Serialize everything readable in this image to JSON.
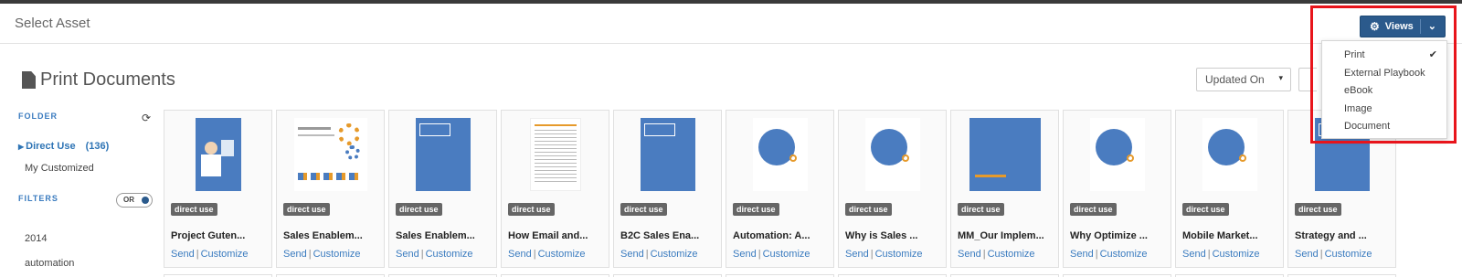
{
  "modal": {
    "title": "Select Asset"
  },
  "views": {
    "button_label": "Views",
    "menu": [
      {
        "label": "Print",
        "checked": true
      },
      {
        "label": "External Playbook",
        "checked": false
      },
      {
        "label": "eBook",
        "checked": false
      },
      {
        "label": "Image",
        "checked": false
      },
      {
        "label": "Document",
        "checked": false
      }
    ],
    "check_glyph": "✔"
  },
  "section": {
    "title": "Print Documents"
  },
  "sort": {
    "selected": "Updated On"
  },
  "sidebar": {
    "folder_label": "FOLDER",
    "folders": [
      {
        "label": "Direct Use",
        "count": "(136)",
        "active": true
      },
      {
        "label": "My Customized",
        "count": "",
        "active": false
      }
    ],
    "filters_label": "FILTERS",
    "toggle_label": "OR",
    "filters": [
      "2014",
      "automation"
    ]
  },
  "cards": [
    {
      "title": "Project Guten...",
      "badge": "direct use",
      "send": "Send",
      "customize": "Customize",
      "thumb": "blue-person"
    },
    {
      "title": "Sales Enablem...",
      "badge": "direct use",
      "send": "Send",
      "customize": "Customize",
      "thumb": "gears"
    },
    {
      "title": "Sales Enablem...",
      "badge": "direct use",
      "send": "Send",
      "customize": "Customize",
      "thumb": "blue-box"
    },
    {
      "title": "How Email and...",
      "badge": "direct use",
      "send": "Send",
      "customize": "Customize",
      "thumb": "text-doc"
    },
    {
      "title": "B2C Sales Ena...",
      "badge": "direct use",
      "send": "Send",
      "customize": "Customize",
      "thumb": "blue-box"
    },
    {
      "title": "Automation: A...",
      "badge": "direct use",
      "send": "Send",
      "customize": "Customize",
      "thumb": "circle"
    },
    {
      "title": "Why is Sales ...",
      "badge": "direct use",
      "send": "Send",
      "customize": "Customize",
      "thumb": "circle"
    },
    {
      "title": "MM_Our Implem...",
      "badge": "direct use",
      "send": "Send",
      "customize": "Customize",
      "thumb": "blue-wide"
    },
    {
      "title": "Why Optimize ...",
      "badge": "direct use",
      "send": "Send",
      "customize": "Customize",
      "thumb": "circle"
    },
    {
      "title": "Mobile Market...",
      "badge": "direct use",
      "send": "Send",
      "customize": "Customize",
      "thumb": "circle"
    },
    {
      "title": "Strategy and ...",
      "badge": "direct use",
      "send": "Send",
      "customize": "Customize",
      "thumb": "blue-box"
    }
  ],
  "colors": {
    "primary": "#2b5a8c",
    "link": "#3a7bbf",
    "thumb_blue": "#4a7cc0",
    "highlight": "#e8141b"
  },
  "icons": {
    "gear": "⚙",
    "chevron": "⌄",
    "refresh": "⟳",
    "sort_caret": "▾"
  }
}
